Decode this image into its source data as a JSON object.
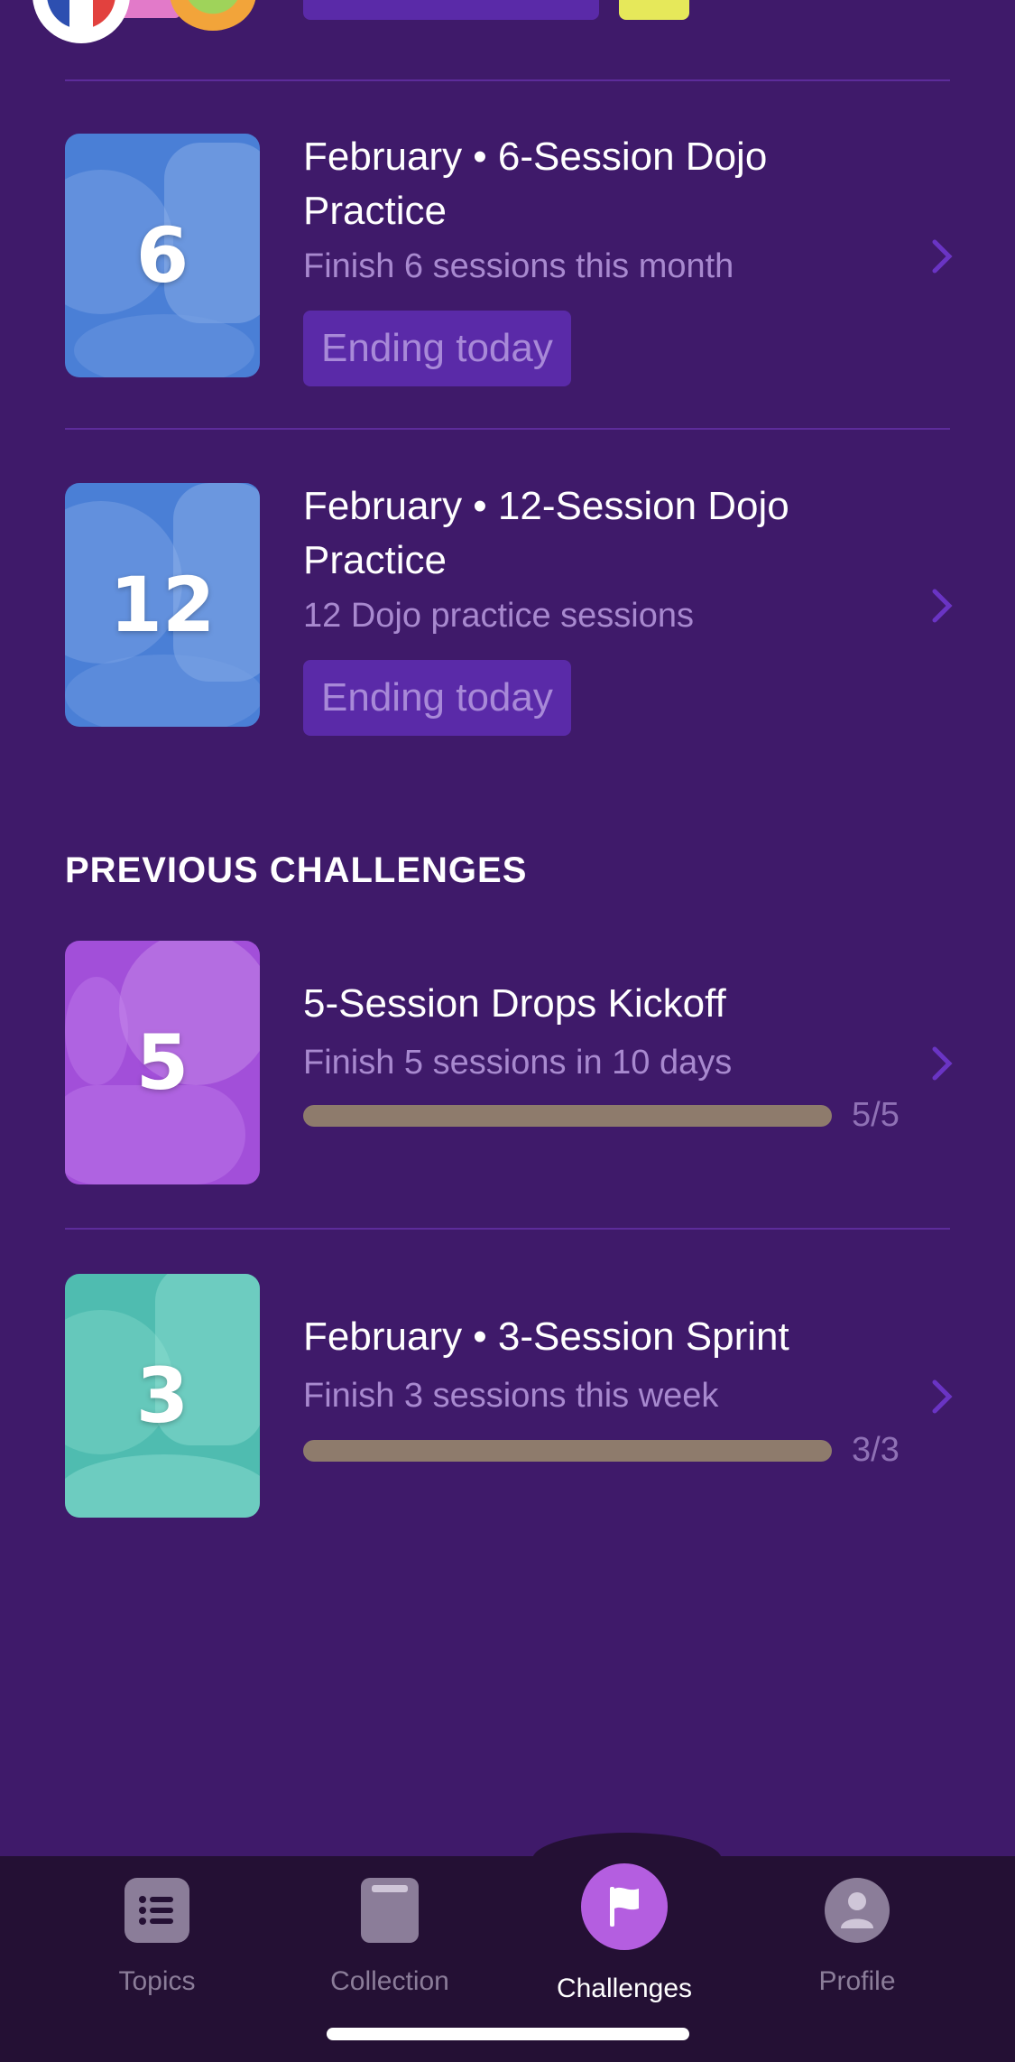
{
  "colors": {
    "background": "#3f1a6a",
    "card_divider": "#5d2c9b",
    "badge_bg": "#5a2aa8",
    "subtitle": "#a889cf",
    "progress": "#8e7b6c",
    "nav_bg": "#241034",
    "nav_active": "#b45ee0",
    "nav_inactive": "#8b7d99"
  },
  "current_challenges": [
    {
      "number": "6",
      "title": "February • 6-Session Dojo Practice",
      "subtitle": "Finish 6 sessions this month",
      "badge": "Ending today",
      "thumb_color": "#4a7fd6"
    },
    {
      "number": "12",
      "title": "February • 12-Session Dojo Practice",
      "subtitle": "12 Dojo practice sessions",
      "badge": "Ending today",
      "thumb_color": "#4a7fd6"
    }
  ],
  "previous_section": {
    "heading": "PREVIOUS CHALLENGES"
  },
  "previous_challenges": [
    {
      "number": "5",
      "title": "5-Session Drops Kickoff",
      "subtitle": "Finish 5 sessions in 10 days",
      "progress_label": "5/5",
      "progress_fraction": 1.0,
      "thumb_color": "#a24fd9"
    },
    {
      "number": "3",
      "title": "February • 3-Session Sprint",
      "subtitle": "Finish 3 sessions this week",
      "progress_label": "3/3",
      "progress_fraction": 1.0,
      "thumb_color": "#4fbcb0"
    }
  ],
  "nav": {
    "items": [
      {
        "label": "Topics",
        "icon": "list-icon",
        "active": false
      },
      {
        "label": "Collection",
        "icon": "book-icon",
        "active": false
      },
      {
        "label": "Challenges",
        "icon": "flag-icon",
        "active": true
      },
      {
        "label": "Profile",
        "icon": "person-icon",
        "active": false
      }
    ]
  }
}
